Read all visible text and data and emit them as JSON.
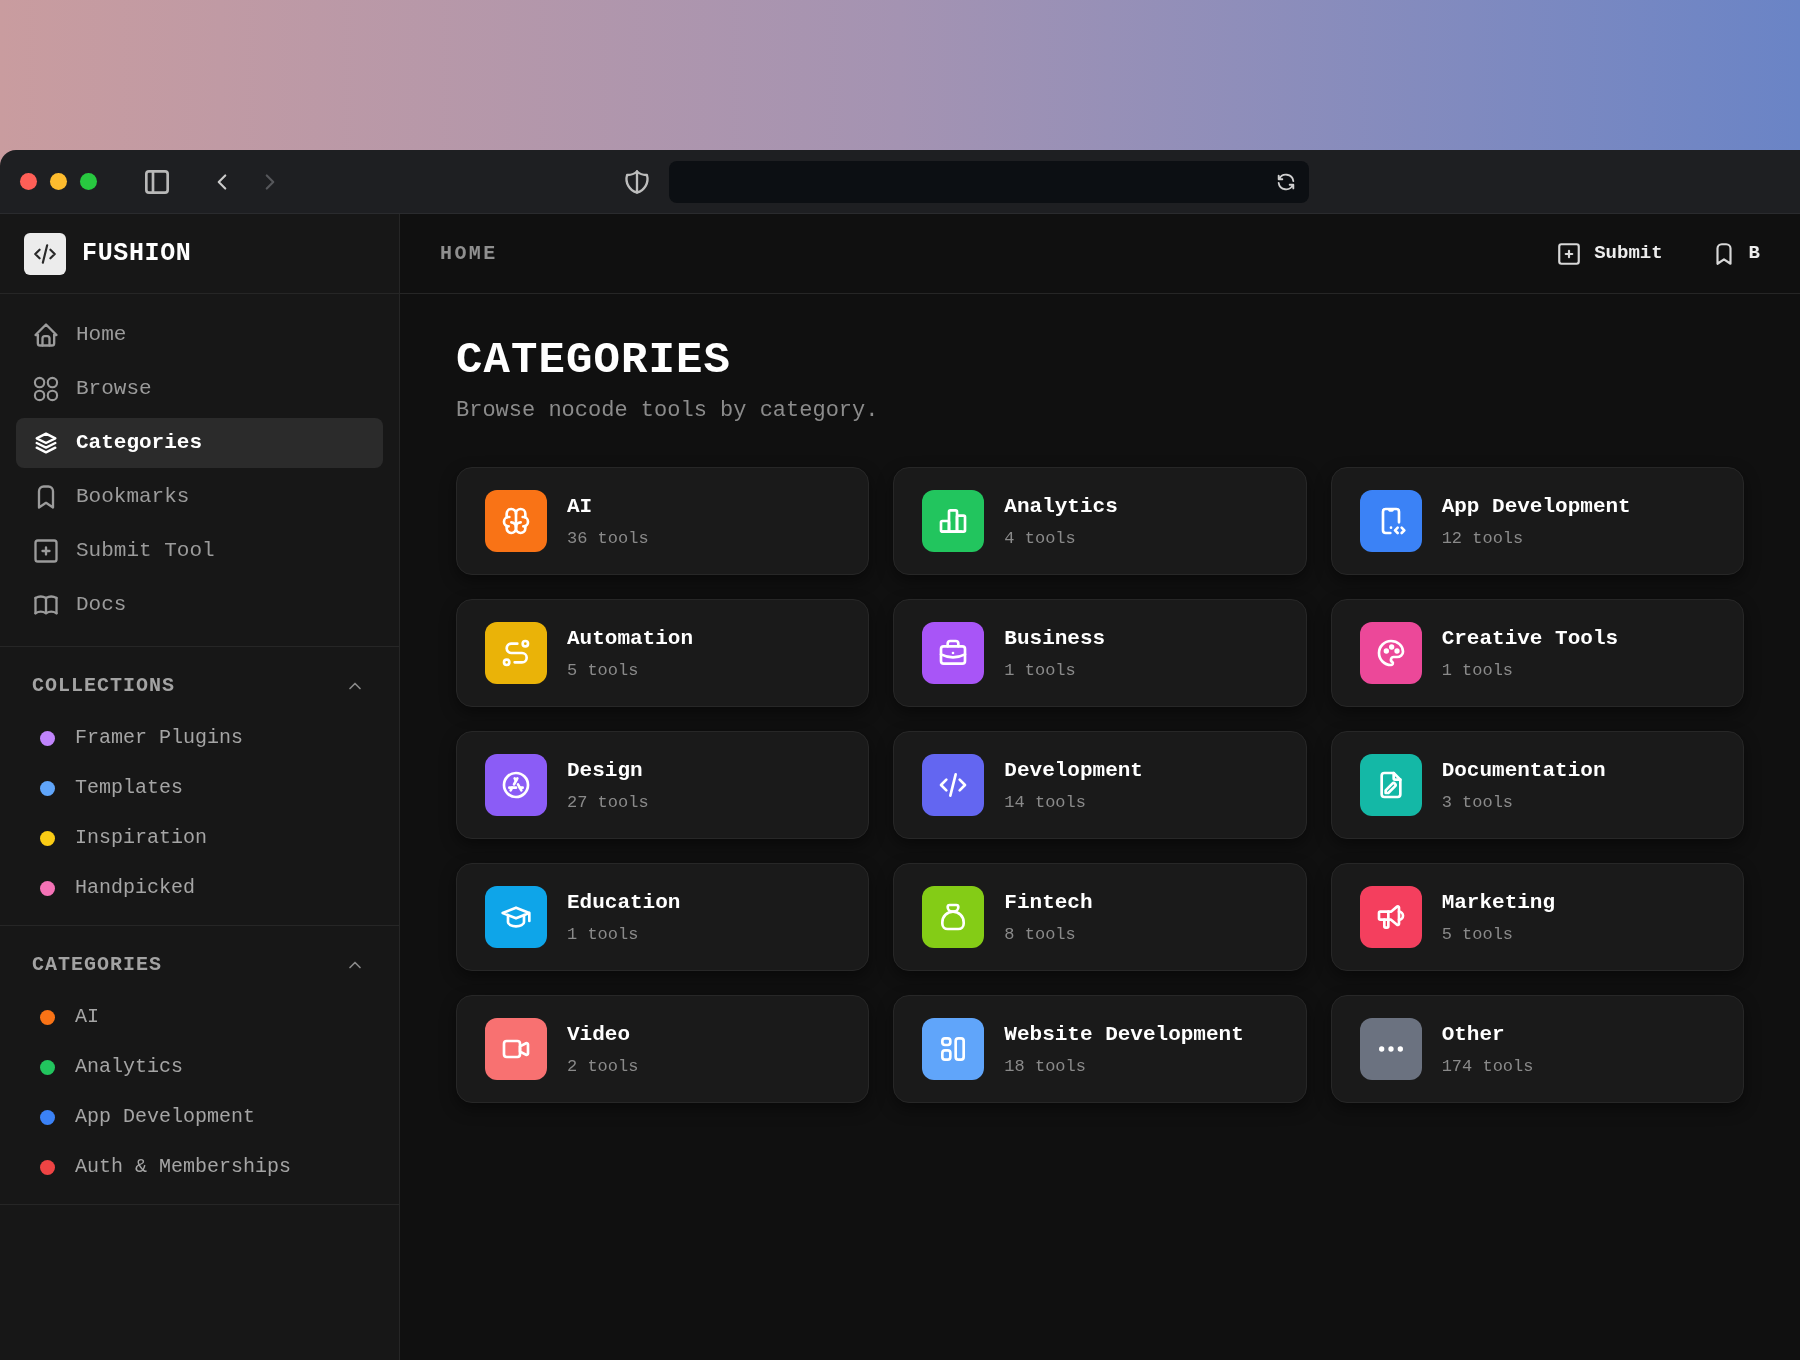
{
  "browser": {
    "navigation": [
      {
        "kind": "back",
        "disabled": false
      },
      {
        "kind": "forward",
        "disabled": true
      }
    ]
  },
  "sidebar": {
    "brand": "FUSHION",
    "nav": [
      {
        "label": "Home",
        "selected": false
      },
      {
        "label": "Browse",
        "selected": false
      },
      {
        "label": "Categories",
        "selected": true
      },
      {
        "label": "Bookmarks",
        "selected": false
      },
      {
        "label": "Submit Tool",
        "selected": false
      },
      {
        "label": "Docs",
        "selected": false
      }
    ],
    "sections": [
      {
        "title": "COLLECTIONS",
        "expanded": true,
        "items": [
          {
            "label": "Framer Plugins",
            "color": "#c084fc"
          },
          {
            "label": "Templates",
            "color": "#60a5fa"
          },
          {
            "label": "Inspiration",
            "color": "#facc15"
          },
          {
            "label": "Handpicked",
            "color": "#f472b6"
          }
        ]
      },
      {
        "title": "CATEGORIES",
        "expanded": true,
        "items": [
          {
            "label": "AI",
            "color": "#f97316"
          },
          {
            "label": "Analytics",
            "color": "#22c55e"
          },
          {
            "label": "App Development",
            "color": "#3b82f6"
          },
          {
            "label": "Auth & Memberships",
            "color": "#ef4444"
          }
        ]
      }
    ]
  },
  "header": {
    "breadcrumb": "HOME",
    "actions": [
      {
        "kind": "submit",
        "label": "Submit"
      },
      {
        "kind": "bookmarks",
        "label": "B"
      }
    ]
  },
  "page": {
    "title": "CATEGORIES",
    "subtitle": "Browse nocode tools by category.",
    "categories": [
      {
        "name": "AI",
        "count": "36 tools",
        "color": "#f97316"
      },
      {
        "name": "Analytics",
        "count": "4 tools",
        "color": "#22c55e"
      },
      {
        "name": "App Development",
        "count": "12 tools",
        "color": "#3b82f6"
      },
      {
        "name": "Automation",
        "count": "5 tools",
        "color": "#eab308"
      },
      {
        "name": "Business",
        "count": "1 tools",
        "color": "#a855f7"
      },
      {
        "name": "Creative Tools",
        "count": "1 tools",
        "color": "#ec4899"
      },
      {
        "name": "Design",
        "count": "27 tools",
        "color": "#8b5cf6"
      },
      {
        "name": "Development",
        "count": "14 tools",
        "color": "#6366f1"
      },
      {
        "name": "Documentation",
        "count": "3 tools",
        "color": "#14b8a6"
      },
      {
        "name": "Education",
        "count": "1 tools",
        "color": "#0ea5e9"
      },
      {
        "name": "Fintech",
        "count": "8 tools",
        "color": "#84cc16"
      },
      {
        "name": "Marketing",
        "count": "5 tools",
        "color": "#f43f5e"
      },
      {
        "name": "Video",
        "count": "2 tools",
        "color": "#f87171"
      },
      {
        "name": "Website Development",
        "count": "18 tools",
        "color": "#60a5fa"
      },
      {
        "name": "Other",
        "count": "174 tools",
        "color": "#6b7280"
      }
    ]
  }
}
